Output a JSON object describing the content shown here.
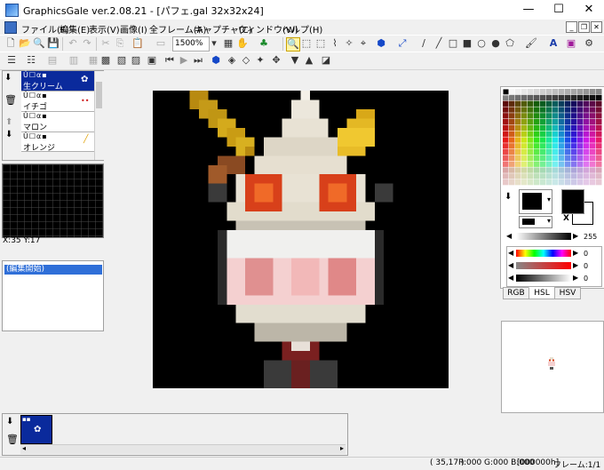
{
  "window": {
    "title": "GraphicsGale ver.2.08.21 - [パフェ.gal 32x32x24]",
    "minimize": "—",
    "maximize": "☐",
    "close": "✕"
  },
  "menu": [
    "ファイル(F)",
    "編集(E)",
    "表示(V)",
    "画像(I)",
    "全フレーム(A)",
    "キャプチャ(C)",
    "ウィンドウ(W)",
    "ヘルプ(H)"
  ],
  "toolbar": {
    "zoom": "1500%"
  },
  "layers": [
    {
      "name": "生クリーム",
      "selected": true
    },
    {
      "name": "イチゴ",
      "selected": false
    },
    {
      "name": "マロン",
      "selected": false
    },
    {
      "name": "オレンジ",
      "selected": false
    }
  ],
  "preview": {
    "coords": "X:35 Y:17"
  },
  "history": {
    "items": [
      "(編集開始)"
    ]
  },
  "colors": {
    "fg_label": "X",
    "slider1_value": "255",
    "r": "0",
    "g": "0",
    "b": "0",
    "tabs": [
      "RGB",
      "HSL",
      "HSV"
    ],
    "active_tab": "HSL",
    "selected_color": "#000000",
    "titlebar_selected": "#0a2a9c"
  },
  "status": {
    "coords": "( 35,17 )",
    "rgb": "R:000 G:000 B:000",
    "hex": "[000000h]",
    "frame": "フレーム:1/1"
  }
}
